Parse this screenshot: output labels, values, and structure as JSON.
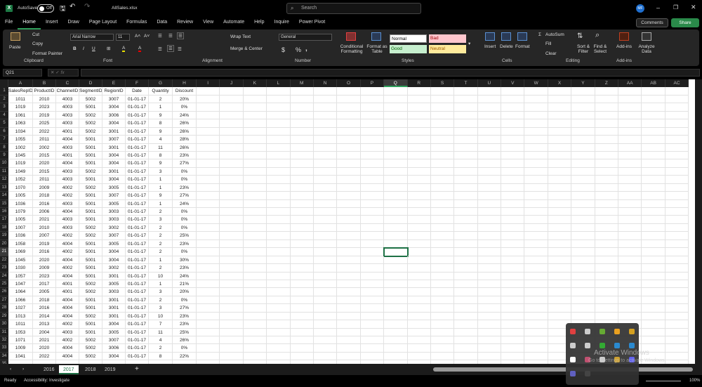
{
  "titlebar": {
    "autosave_label": "AutoSave",
    "autosave_state": "Off",
    "filename": "AllSales.xlsx",
    "search_placeholder": "Search",
    "user_initials": "MF"
  },
  "menu": {
    "tabs": [
      "File",
      "Home",
      "Insert",
      "Draw",
      "Page Layout",
      "Formulas",
      "Data",
      "Review",
      "View",
      "Automate",
      "Help",
      "Inquire",
      "Power Pivot"
    ],
    "active": "Home",
    "comments": "Comments",
    "share": "Share"
  },
  "ribbon": {
    "clipboard": {
      "paste": "Paste",
      "cut": "Cut",
      "copy": "Copy",
      "format_painter": "Format Painter",
      "label": "Clipboard"
    },
    "font": {
      "name": "Arial Narrow",
      "size": "11",
      "bold": "B",
      "italic": "I",
      "underline": "U",
      "label": "Font"
    },
    "alignment": {
      "wrap": "Wrap Text",
      "merge": "Merge & Center",
      "label": "Alignment"
    },
    "number": {
      "format": "General",
      "currency": "$",
      "percent": "%",
      "comma": ",",
      "label": "Number"
    },
    "styles": {
      "conditional": "Conditional Formatting",
      "format_table": "Format as Table",
      "normal": "Normal",
      "bad": "Bad",
      "good": "Good",
      "neutral": "Neutral",
      "label": "Styles"
    },
    "cells": {
      "insert": "Insert",
      "delete": "Delete",
      "format": "Format",
      "label": "Cells"
    },
    "editing": {
      "autosum": "AutoSum",
      "fill": "Fill",
      "clear": "Clear",
      "sort": "Sort & Filter",
      "find": "Find & Select",
      "label": "Editing"
    },
    "addins": {
      "addins": "Add-ins",
      "label": "Add-ins"
    },
    "analyze": {
      "label": "Analyze Data"
    }
  },
  "formula_bar": {
    "name_box": "Q21",
    "fx": "fx",
    "value": ""
  },
  "sheet": {
    "columns": [
      "A",
      "B",
      "C",
      "D",
      "E",
      "F",
      "G",
      "H",
      "I",
      "J",
      "K",
      "L",
      "M",
      "N",
      "O",
      "P",
      "Q",
      "R",
      "S",
      "T",
      "U",
      "V",
      "W",
      "X",
      "Y",
      "Z",
      "AA",
      "AB",
      "AC"
    ],
    "selected_column": "Q",
    "selected_row": 21,
    "headers": [
      "SalesRepID",
      "ProductID",
      "ChannelID",
      "SegmentID",
      "RegionID",
      "Date",
      "Quantity",
      "Discount"
    ],
    "rows": [
      [
        "1011",
        "2010",
        "4003",
        "5002",
        "3007",
        "01-01-17",
        "2",
        "20%"
      ],
      [
        "1019",
        "2023",
        "4003",
        "5001",
        "3004",
        "01-01-17",
        "1",
        "0%"
      ],
      [
        "1061",
        "2019",
        "4003",
        "5002",
        "3006",
        "01-01-17",
        "9",
        "24%"
      ],
      [
        "1063",
        "2025",
        "4003",
        "5002",
        "3004",
        "01-01-17",
        "8",
        "26%"
      ],
      [
        "1034",
        "2022",
        "4001",
        "5002",
        "3001",
        "01-01-17",
        "9",
        "26%"
      ],
      [
        "1055",
        "2011",
        "4004",
        "5001",
        "3007",
        "01-01-17",
        "4",
        "28%"
      ],
      [
        "1002",
        "2002",
        "4003",
        "5001",
        "3001",
        "01-01-17",
        "11",
        "26%"
      ],
      [
        "1045",
        "2015",
        "4001",
        "5001",
        "3004",
        "01-01-17",
        "8",
        "23%"
      ],
      [
        "1019",
        "2020",
        "4004",
        "5001",
        "3004",
        "01-01-17",
        "9",
        "27%"
      ],
      [
        "1049",
        "2015",
        "4003",
        "5002",
        "3001",
        "01-01-17",
        "3",
        "0%"
      ],
      [
        "1052",
        "2011",
        "4003",
        "5001",
        "3004",
        "01-01-17",
        "1",
        "0%"
      ],
      [
        "1070",
        "2009",
        "4002",
        "5002",
        "3005",
        "01-01-17",
        "1",
        "23%"
      ],
      [
        "1005",
        "2018",
        "4002",
        "5001",
        "3007",
        "01-01-17",
        "9",
        "27%"
      ],
      [
        "1036",
        "2016",
        "4003",
        "5001",
        "3005",
        "01-01-17",
        "1",
        "24%"
      ],
      [
        "1079",
        "2006",
        "4004",
        "5001",
        "3003",
        "01-01-17",
        "2",
        "0%"
      ],
      [
        "1005",
        "2021",
        "4003",
        "5001",
        "3003",
        "01-01-17",
        "3",
        "0%"
      ],
      [
        "1007",
        "2010",
        "4003",
        "5002",
        "3002",
        "01-01-17",
        "2",
        "0%"
      ],
      [
        "1036",
        "2007",
        "4002",
        "5002",
        "3007",
        "01-01-17",
        "2",
        "25%"
      ],
      [
        "1058",
        "2019",
        "4004",
        "5001",
        "3005",
        "01-01-17",
        "2",
        "23%"
      ],
      [
        "1069",
        "2016",
        "4002",
        "5001",
        "3004",
        "01-01-17",
        "2",
        "0%"
      ],
      [
        "1045",
        "2020",
        "4004",
        "5001",
        "3004",
        "01-01-17",
        "1",
        "30%"
      ],
      [
        "1030",
        "2009",
        "4002",
        "5001",
        "3002",
        "01-01-17",
        "2",
        "23%"
      ],
      [
        "1057",
        "2023",
        "4004",
        "5001",
        "3001",
        "01-01-17",
        "10",
        "24%"
      ],
      [
        "1047",
        "2017",
        "4001",
        "5002",
        "3005",
        "01-01-17",
        "1",
        "21%"
      ],
      [
        "1064",
        "2005",
        "4001",
        "5002",
        "3003",
        "01-01-17",
        "3",
        "20%"
      ],
      [
        "1066",
        "2018",
        "4004",
        "5001",
        "3001",
        "01-01-17",
        "2",
        "0%"
      ],
      [
        "1027",
        "2016",
        "4004",
        "5001",
        "3001",
        "01-01-17",
        "3",
        "27%"
      ],
      [
        "1013",
        "2014",
        "4004",
        "5002",
        "3001",
        "01-01-17",
        "10",
        "23%"
      ],
      [
        "1011",
        "2013",
        "4002",
        "5001",
        "3004",
        "01-01-17",
        "7",
        "23%"
      ],
      [
        "1053",
        "2004",
        "4003",
        "5001",
        "3005",
        "01-01-17",
        "11",
        "25%"
      ],
      [
        "1071",
        "2021",
        "4002",
        "5002",
        "3007",
        "01-01-17",
        "4",
        "26%"
      ],
      [
        "1009",
        "2020",
        "4004",
        "5002",
        "3006",
        "01-01-17",
        "2",
        "0%"
      ],
      [
        "1041",
        "2022",
        "4004",
        "5002",
        "3004",
        "01-01-17",
        "8",
        "22%"
      ]
    ]
  },
  "sheet_tabs": {
    "tabs": [
      "2016",
      "2017",
      "2018",
      "2019"
    ],
    "active": "2017",
    "add": "+"
  },
  "status": {
    "ready": "Ready",
    "accessibility": "Accessibility: Investigate",
    "zoom": "100%"
  },
  "watermark": {
    "line1": "Activate Windows",
    "line2": "Go to Settings to activate Windows."
  },
  "colors": {
    "excel_green": "#1e7145",
    "share_green": "#2a8a4a"
  }
}
